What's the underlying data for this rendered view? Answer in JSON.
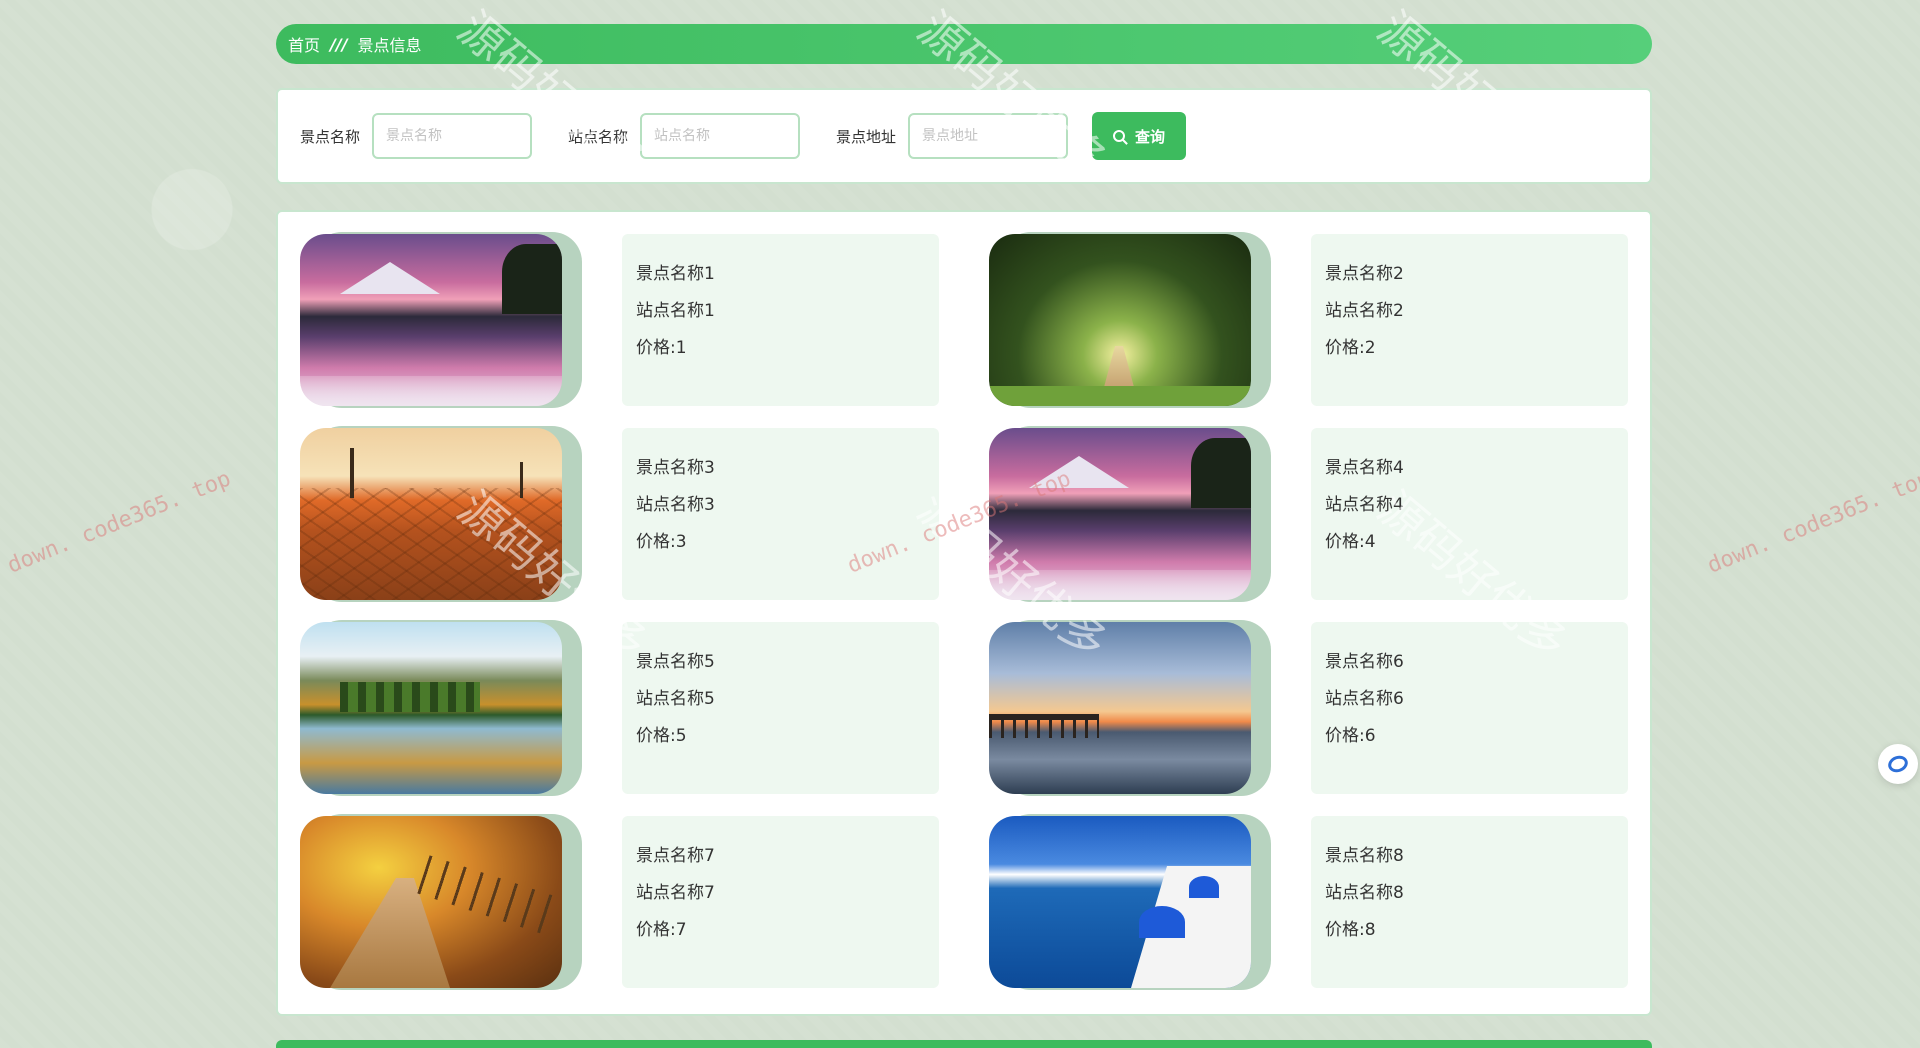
{
  "breadcrumb": {
    "home": "首页",
    "separator": "///",
    "current": "景点信息"
  },
  "search": {
    "fields": [
      {
        "label": "景点名称",
        "placeholder": "景点名称",
        "value": ""
      },
      {
        "label": "站点名称",
        "placeholder": "站点名称",
        "value": ""
      },
      {
        "label": "景点地址",
        "placeholder": "景点地址",
        "value": ""
      }
    ],
    "button_label": "查询"
  },
  "items": [
    {
      "name": "景点名称1",
      "station": "站点名称1",
      "price": "价格:1",
      "scene": "mountain-lake"
    },
    {
      "name": "景点名称2",
      "station": "站点名称2",
      "price": "价格:2",
      "scene": "forest-path"
    },
    {
      "name": "景点名称3",
      "station": "站点名称3",
      "price": "价格:3",
      "scene": "desert"
    },
    {
      "name": "景点名称4",
      "station": "站点名称4",
      "price": "价格:4",
      "scene": "mountain-lake"
    },
    {
      "name": "景点名称5",
      "station": "站点名称5",
      "price": "价格:5",
      "scene": "autumn-lake"
    },
    {
      "name": "景点名称6",
      "station": "站点名称6",
      "price": "价格:6",
      "scene": "sunset-pier"
    },
    {
      "name": "景点名称7",
      "station": "站点名称7",
      "price": "价格:7",
      "scene": "autumn-path"
    },
    {
      "name": "景点名称8",
      "station": "站点名称8",
      "price": "价格:8",
      "scene": "santorini"
    }
  ],
  "watermarks": {
    "big": "源码好优多",
    "small": "down. code365. top"
  },
  "colors": {
    "accent": "#3dbb5e",
    "panel_border": "#c8e6cf",
    "info_bg": "#eef8f0"
  }
}
